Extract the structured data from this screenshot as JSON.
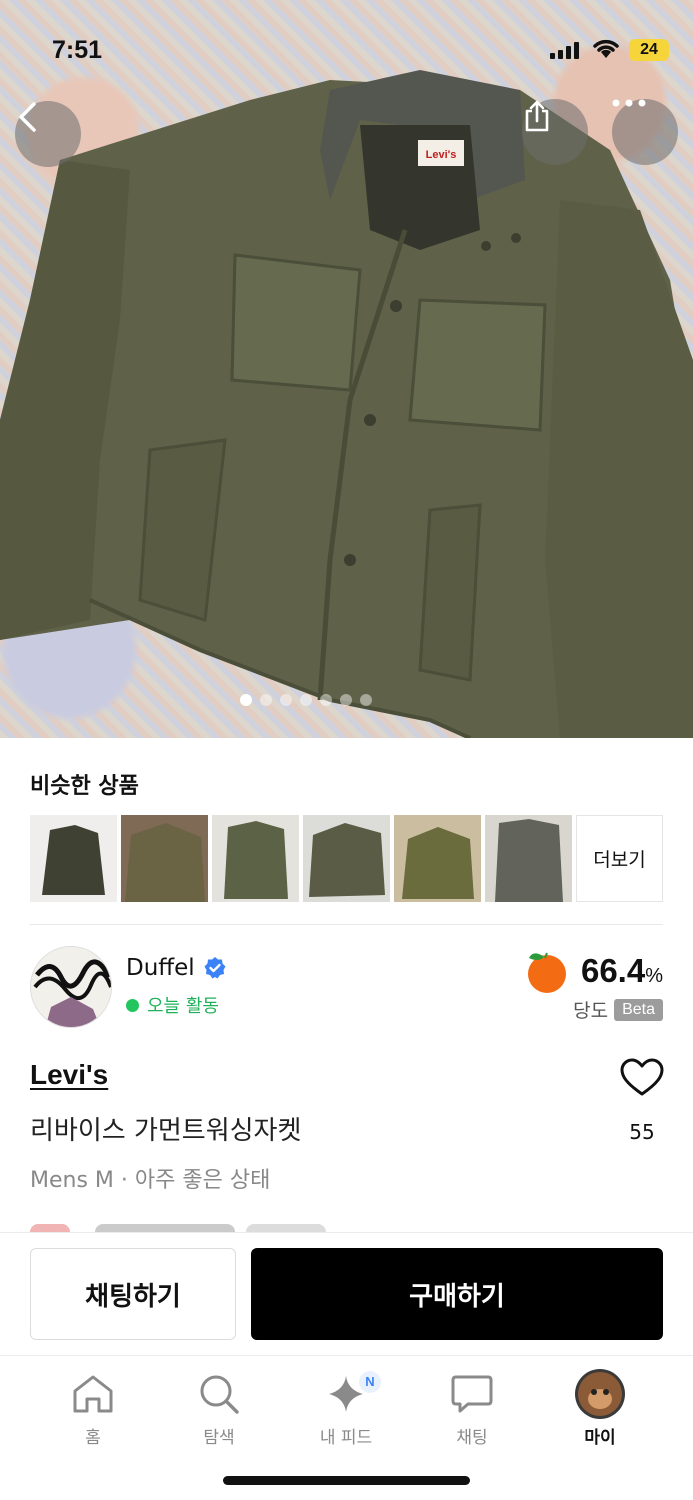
{
  "status_bar": {
    "time": "7:51",
    "battery": "24",
    "battery_color": "#f6d53a"
  },
  "hero": {
    "icons": {
      "back": "chevron-left-icon",
      "share": "share-icon",
      "more": "more-horizontal-icon"
    },
    "image_count": 7,
    "active_index": 1,
    "garment_label": "Levi's"
  },
  "similar": {
    "title": "비슷한 상품",
    "items": [
      {
        "name": "similar-item-1"
      },
      {
        "name": "similar-item-2"
      },
      {
        "name": "similar-item-3"
      },
      {
        "name": "similar-item-4"
      },
      {
        "name": "similar-item-5"
      },
      {
        "name": "similar-item-6"
      }
    ],
    "more_label": "더보기"
  },
  "seller": {
    "name": "Duffel",
    "verified_icon": "verified-badge-icon",
    "status": "오늘 활동",
    "status_color": "#22c55e",
    "score_value": "66.4",
    "score_unit": "%",
    "score_icon": "tangerine-icon",
    "score_label": "당도",
    "beta_label": "Beta"
  },
  "product": {
    "brand": "Levi's",
    "title": "리바이스 가먼트워싱자켓",
    "subtitle": "Mens M · 아주 좋은 상태",
    "like_count": "55"
  },
  "actions": {
    "chat_label": "채팅하기",
    "buy_label": "구매하기"
  },
  "tabbar": {
    "items": [
      {
        "label": "홈",
        "icon": "home-icon"
      },
      {
        "label": "탐색",
        "icon": "search-icon"
      },
      {
        "label": "내 피드",
        "icon": "sparkle-icon",
        "badge": "N"
      },
      {
        "label": "채팅",
        "icon": "chat-bubble-icon"
      },
      {
        "label": "마이",
        "icon": "profile-avatar-icon"
      }
    ],
    "active": "마이",
    "badge_color": "#3b82f6"
  }
}
